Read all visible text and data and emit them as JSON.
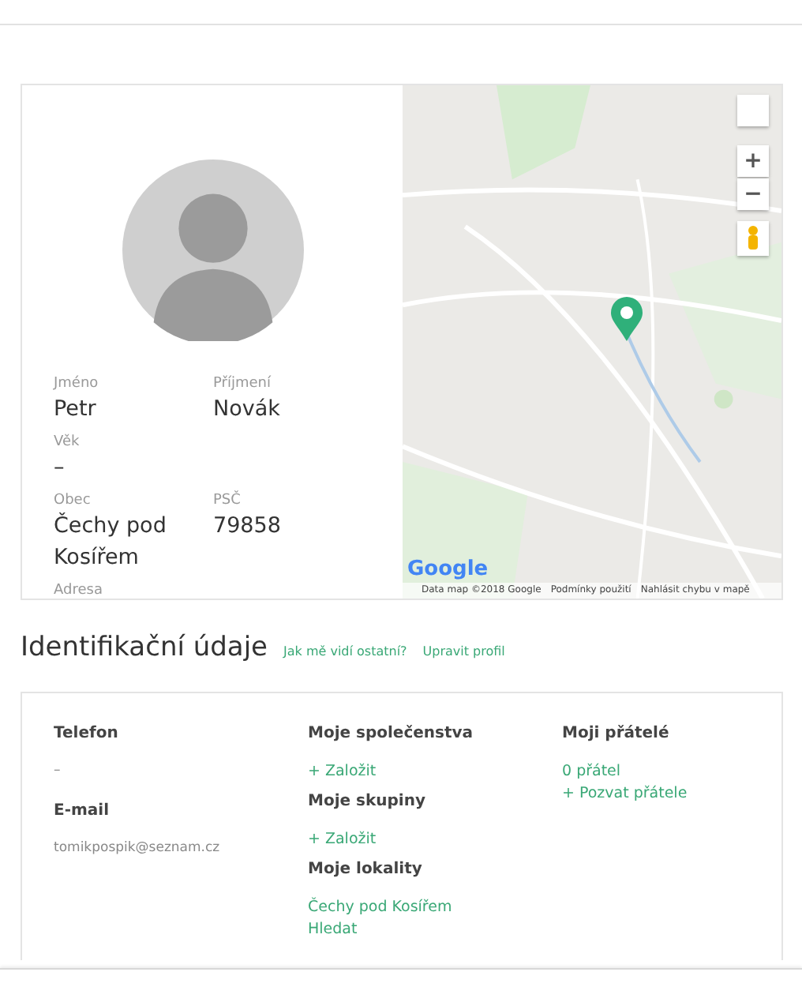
{
  "profile": {
    "fields": [
      {
        "label": "Jméno",
        "value": "Petr"
      },
      {
        "label": "Příjmení",
        "value": "Novák"
      },
      {
        "label": "Věk",
        "value": "–",
        "kind": "full"
      },
      {
        "label": "Obec",
        "value": "Čechy pod Kosířem"
      },
      {
        "label": "PSČ",
        "value": "79858"
      },
      {
        "label": "Adresa"
      }
    ],
    "map": {
      "zoom_in": "+",
      "zoom_out": "−",
      "logo": "Google",
      "attribution": [
        "Data map ©2018 Google",
        "Podmínky použití",
        "Nahlásit chybu v mapě"
      ]
    }
  },
  "section": {
    "title": "Identifikační údaje",
    "links": [
      "Jak mě vidí ostatní?",
      "Upravit profil"
    ]
  },
  "info": {
    "columns": [
      [
        {
          "kind": "heading",
          "text": "Telefon"
        },
        {
          "kind": "value",
          "text": "–"
        },
        {
          "kind": "heading",
          "text": "E-mail"
        },
        {
          "kind": "value",
          "text": "tomikpospik@seznam.cz"
        }
      ],
      [
        {
          "kind": "heading",
          "text": "Moje společenstva"
        },
        {
          "kind": "link",
          "text": "+ Založit"
        },
        {
          "kind": "heading",
          "text": "Moje skupiny"
        },
        {
          "kind": "link",
          "text": "+ Založit"
        },
        {
          "kind": "heading",
          "text": "Moje lokality"
        },
        {
          "kind": "link",
          "text": "Čechy pod Kosířem"
        },
        {
          "kind": "link",
          "text": "Hledat"
        }
      ],
      [
        {
          "kind": "heading",
          "text": "Moji přátelé"
        },
        {
          "kind": "link",
          "text": "0 přátel"
        },
        {
          "kind": "link",
          "text": "+ Pozvat přátele"
        }
      ]
    ]
  }
}
